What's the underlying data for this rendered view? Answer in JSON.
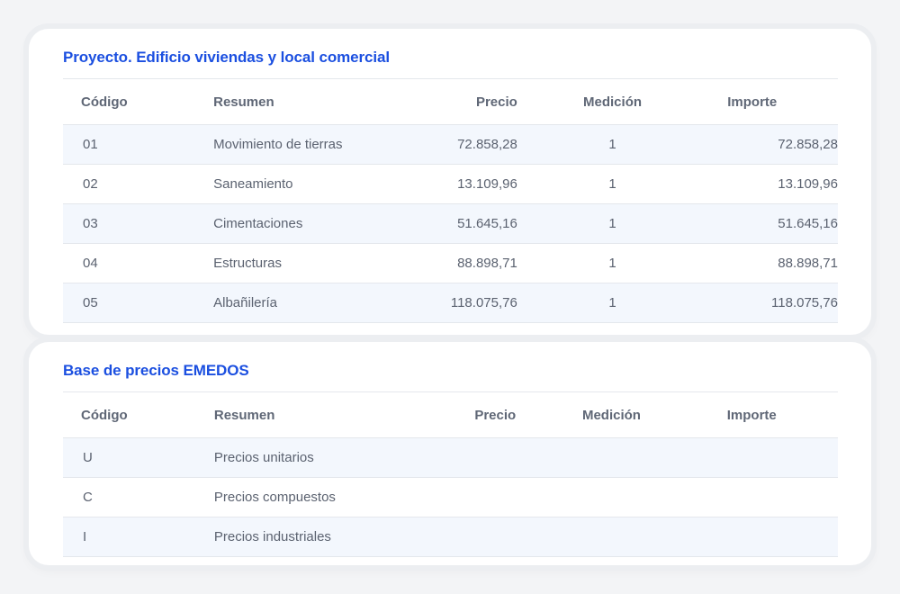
{
  "proyecto": {
    "title": "Proyecto. Edificio viviendas y local comercial",
    "columns": {
      "codigo": "Código",
      "resumen": "Resumen",
      "precio": "Precio",
      "medicion": "Medición",
      "importe": "Importe"
    },
    "rows": [
      {
        "codigo": "01",
        "resumen": "Movimiento de tierras",
        "precio": "72.858,28",
        "medicion": "1",
        "importe": "72.858,28"
      },
      {
        "codigo": "02",
        "resumen": "Saneamiento",
        "precio": "13.109,96",
        "medicion": "1",
        "importe": "13.109,96"
      },
      {
        "codigo": "03",
        "resumen": "Cimentaciones",
        "precio": "51.645,16",
        "medicion": "1",
        "importe": "51.645,16"
      },
      {
        "codigo": "04",
        "resumen": "Estructuras",
        "precio": "88.898,71",
        "medicion": "1",
        "importe": "88.898,71"
      },
      {
        "codigo": "05",
        "resumen": "Albañilería",
        "precio": "118.075,76",
        "medicion": "1",
        "importe": "118.075,76"
      }
    ]
  },
  "base": {
    "title": "Base de precios EMEDOS",
    "columns": {
      "codigo": "Código",
      "resumen": "Resumen",
      "precio": "Precio",
      "medicion": "Medición",
      "importe": "Importe"
    },
    "rows": [
      {
        "codigo": "U",
        "resumen": "Precios unitarios"
      },
      {
        "codigo": "C",
        "resumen": "Precios compuestos"
      },
      {
        "codigo": "I",
        "resumen": "Precios industriales"
      }
    ]
  },
  "colors": {
    "accent": "#1b4fe0",
    "row_stripe": "#f3f7fd"
  }
}
